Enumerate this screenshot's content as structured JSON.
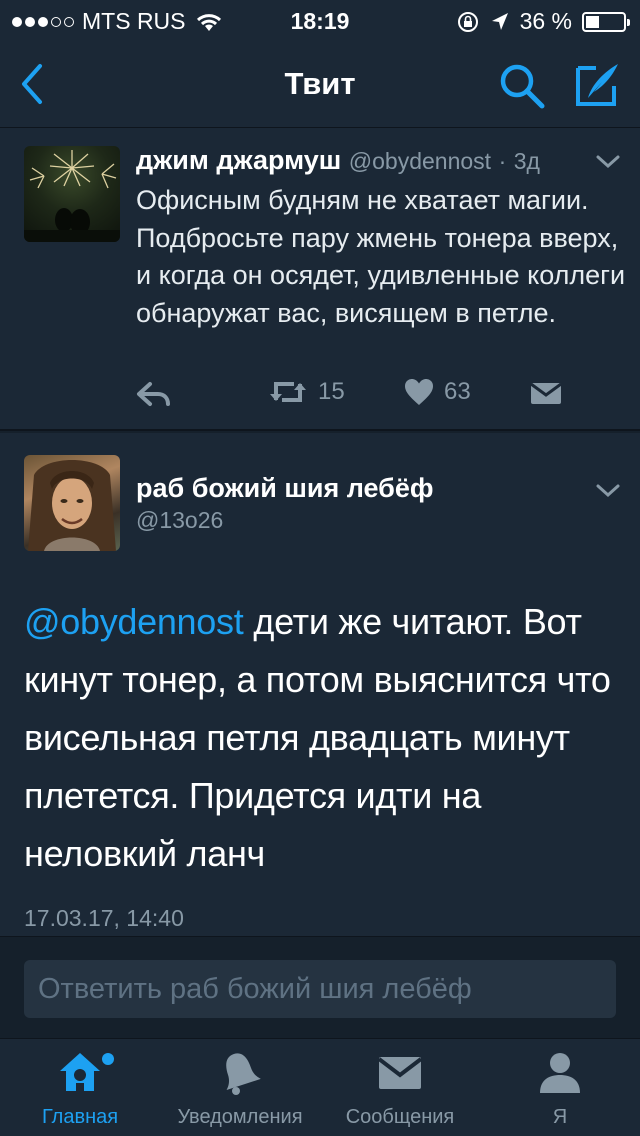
{
  "status_bar": {
    "carrier": "MTS RUS",
    "time": "18:19",
    "battery_percent": "36 %",
    "battery_level": 0.36,
    "signal_bars_filled": 3,
    "signal_bars_total": 5
  },
  "nav": {
    "title": "Твит",
    "back_icon": "chevron-left-icon",
    "search_icon": "search-icon",
    "compose_icon": "compose-tweet-icon"
  },
  "tweet_quoted": {
    "name": "джим джармуш",
    "handle": "@obydennost",
    "age": "3д",
    "text": "Офисным будням не хватает магии. Подбросьте пару жмень тонера вверх, и когда он осядет, удивленные коллеги обнаружат вас, висящем в петле.",
    "retweets": "15",
    "likes": "63"
  },
  "tweet_main": {
    "name": "раб божий шия лебёф",
    "handle": "@13o26",
    "mention": "@obydennost",
    "text": "дети же читают. Вот кинут тонер, а потом выяснится что висельная петля двадцать минут плетется. Придется идти на неловкий ланч",
    "timestamp": "17.03.17, 14:40"
  },
  "reply": {
    "placeholder": "Ответить раб божий шия лебёф"
  },
  "tabs": [
    {
      "label": "Главная",
      "icon": "home-icon",
      "active": true
    },
    {
      "label": "Уведомления",
      "icon": "bell-icon",
      "active": false
    },
    {
      "label": "Сообщения",
      "icon": "envelope-icon",
      "active": false
    },
    {
      "label": "Я",
      "icon": "profile-icon",
      "active": false
    }
  ],
  "colors": {
    "accent": "#1da1f2",
    "background": "#15202b",
    "card": "#1b2836",
    "muted": "#8899a6"
  }
}
